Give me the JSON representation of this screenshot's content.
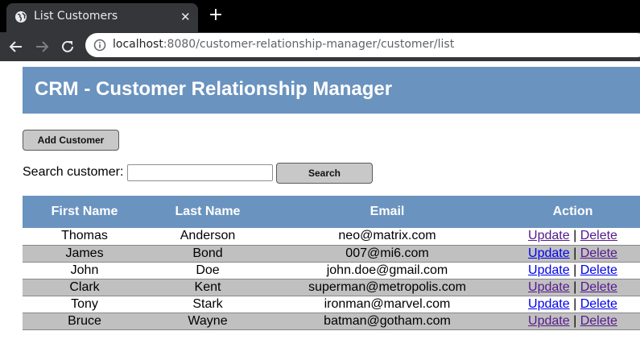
{
  "browser": {
    "tab_title": "List Customers",
    "url_host": "localhost",
    "url_rest": ":8080/customer-relationship-manager/customer/list"
  },
  "page": {
    "heading": "CRM - Customer Relationship Manager",
    "add_button": "Add Customer",
    "search_label": "Search customer:",
    "search_value": "",
    "search_button": "Search",
    "table": {
      "columns": [
        "First Name",
        "Last Name",
        "Email",
        "Action"
      ],
      "rows": [
        {
          "first": "Thomas",
          "last": "Anderson",
          "email": "neo@matrix.com",
          "update": "Update",
          "sep": "|",
          "delete": "Delete"
        },
        {
          "first": "James",
          "last": "Bond",
          "email": "007@mi6.com",
          "update": "Update",
          "sep": "|",
          "delete": "Delete"
        },
        {
          "first": "John",
          "last": "Doe",
          "email": "john.doe@gmail.com",
          "update": "Update",
          "sep": "|",
          "delete": "Delete"
        },
        {
          "first": "Clark",
          "last": "Kent",
          "email": "superman@metropolis.com",
          "update": "Update",
          "sep": "|",
          "delete": "Delete"
        },
        {
          "first": "Tony",
          "last": "Stark",
          "email": "ironman@marvel.com",
          "update": "Update",
          "sep": "|",
          "delete": "Delete"
        },
        {
          "first": "Bruce",
          "last": "Wayne",
          "email": "batman@gotham.com",
          "update": "Update",
          "sep": "|",
          "delete": "Delete"
        }
      ]
    }
  },
  "colors": {
    "header_bg": "#6a93bf",
    "row_alt_bg": "#c0c0c0",
    "link": "#0000ee",
    "link_visited": "#551a8b"
  }
}
